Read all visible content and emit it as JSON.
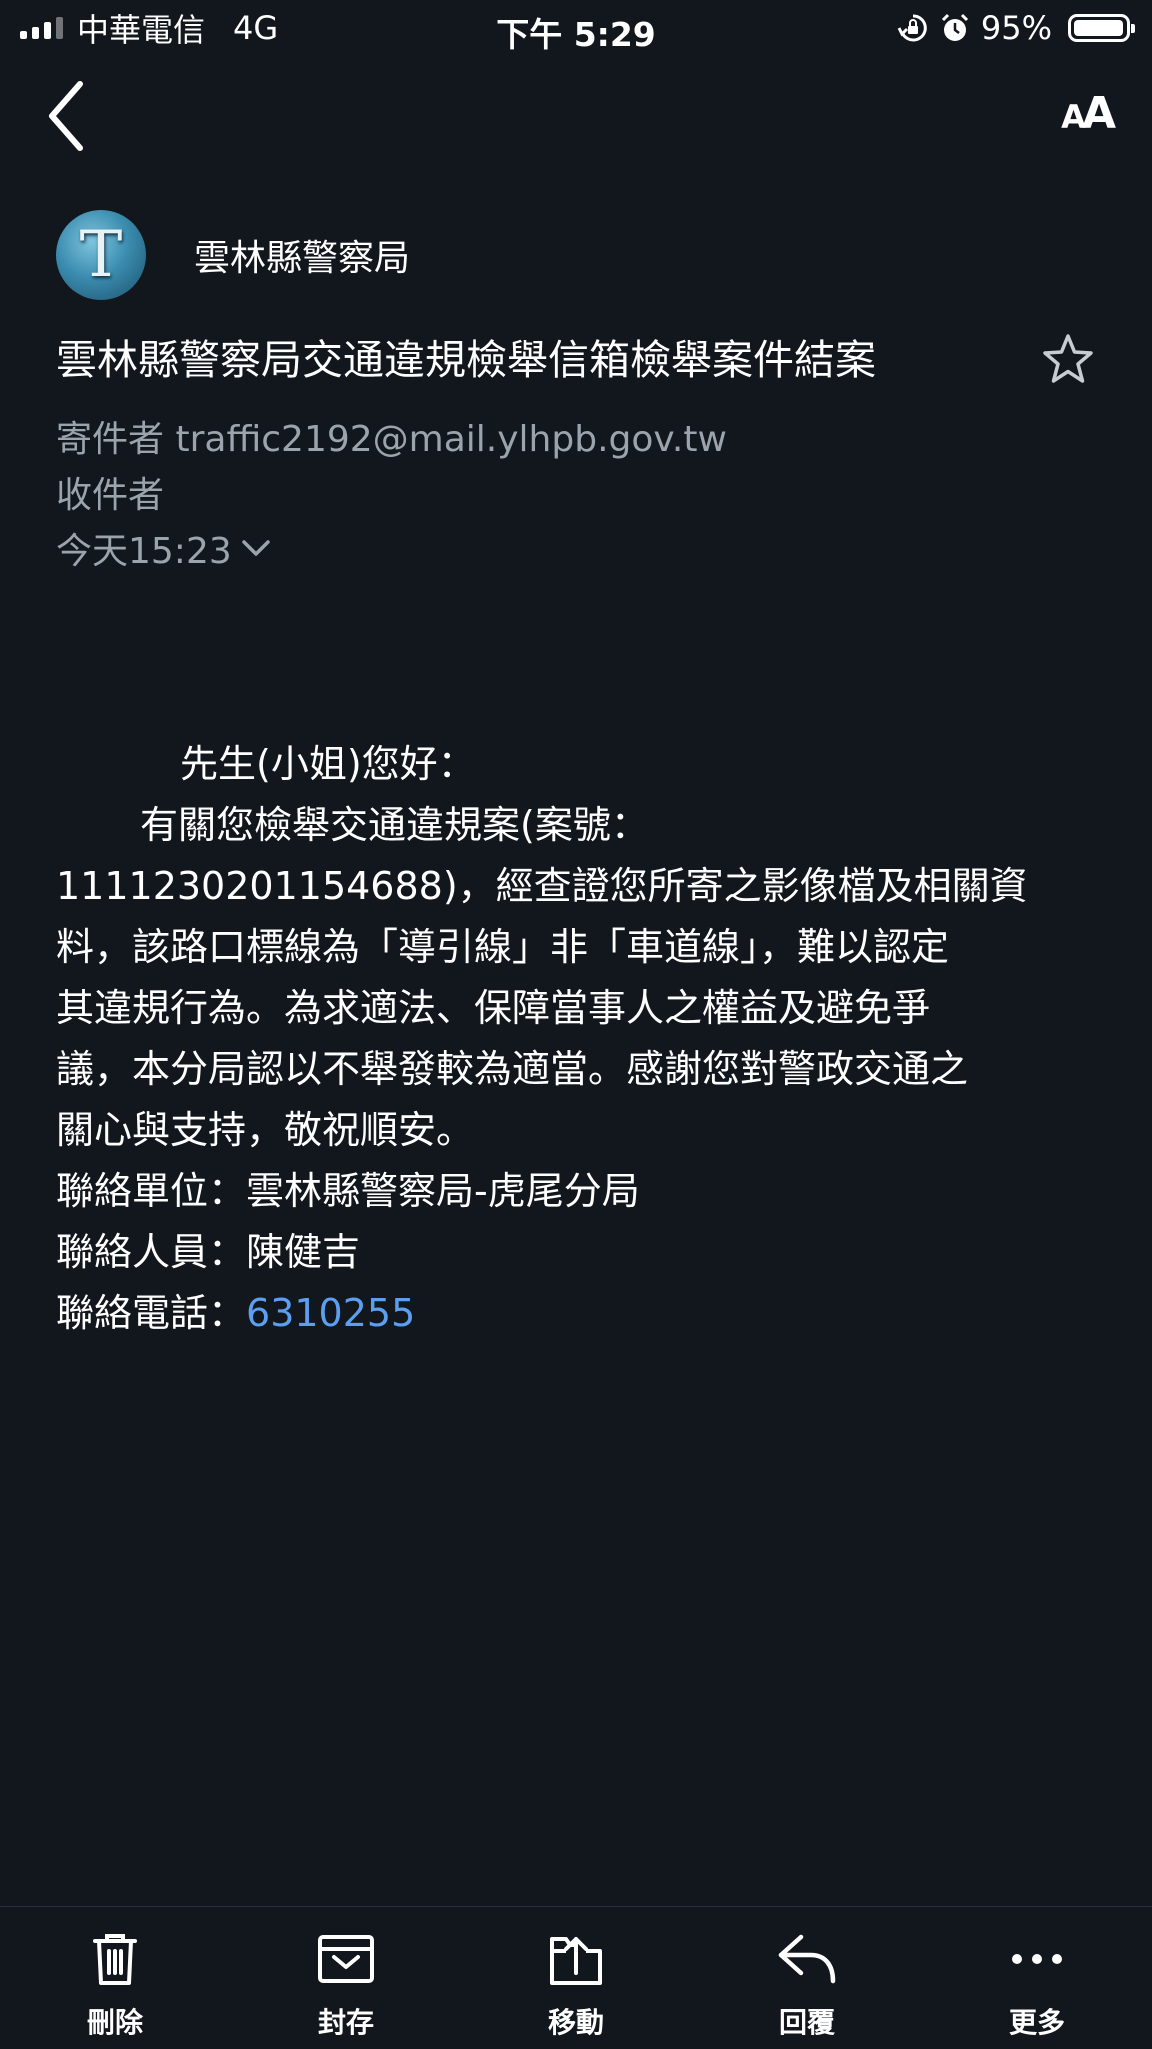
{
  "status_bar": {
    "carrier": "中華電信",
    "network": "4G",
    "time": "下午 5:29",
    "battery": "95%",
    "battery_level": 0.95
  },
  "nav": {
    "back_icon": "chevron-left-icon",
    "text_size_icon": "text-size-icon"
  },
  "email": {
    "avatar_letter": "T",
    "sender_name": "雲林縣警察局",
    "subject": "雲林縣警察局交通違規檢舉信箱檢舉案件結案",
    "from_label": "寄件者",
    "from_address": "traffic2192@mail.ylhpb.gov.tw",
    "to_label": "收件者",
    "date": "今天15:23",
    "body": {
      "greeting": "先生(小姐)您好：",
      "para_line1": "有關您檢舉交通違規案(案號：",
      "para_line2": "1111230201154688)，經查證您所寄之影像檔及相關資",
      "para_line3": "料，該路口標線為「導引線」非「車道線」，難以認定",
      "para_line4": "其違規行為。為求適法、保障當事人之權益及避免爭",
      "para_line5": "議，本分局認以不舉發較為適當。感謝您對警政交通之",
      "para_line6": "關心與支持，敬祝順安。",
      "contact_unit": "聯絡單位：雲林縣警察局-虎尾分局",
      "contact_person": "聯絡人員：陳健吉",
      "contact_phone_label": "聯絡電話：",
      "contact_phone": "6310255"
    }
  },
  "toolbar": {
    "items": [
      {
        "label": "刪除",
        "icon": "trash-icon"
      },
      {
        "label": "封存",
        "icon": "archive-icon"
      },
      {
        "label": "移動",
        "icon": "move-folder-icon"
      },
      {
        "label": "回覆",
        "icon": "reply-icon"
      },
      {
        "label": "更多",
        "icon": "more-icon"
      }
    ]
  },
  "colors": {
    "background": "#12171d",
    "meta_text": "#9ba3ad",
    "link": "#5c9ff0"
  }
}
